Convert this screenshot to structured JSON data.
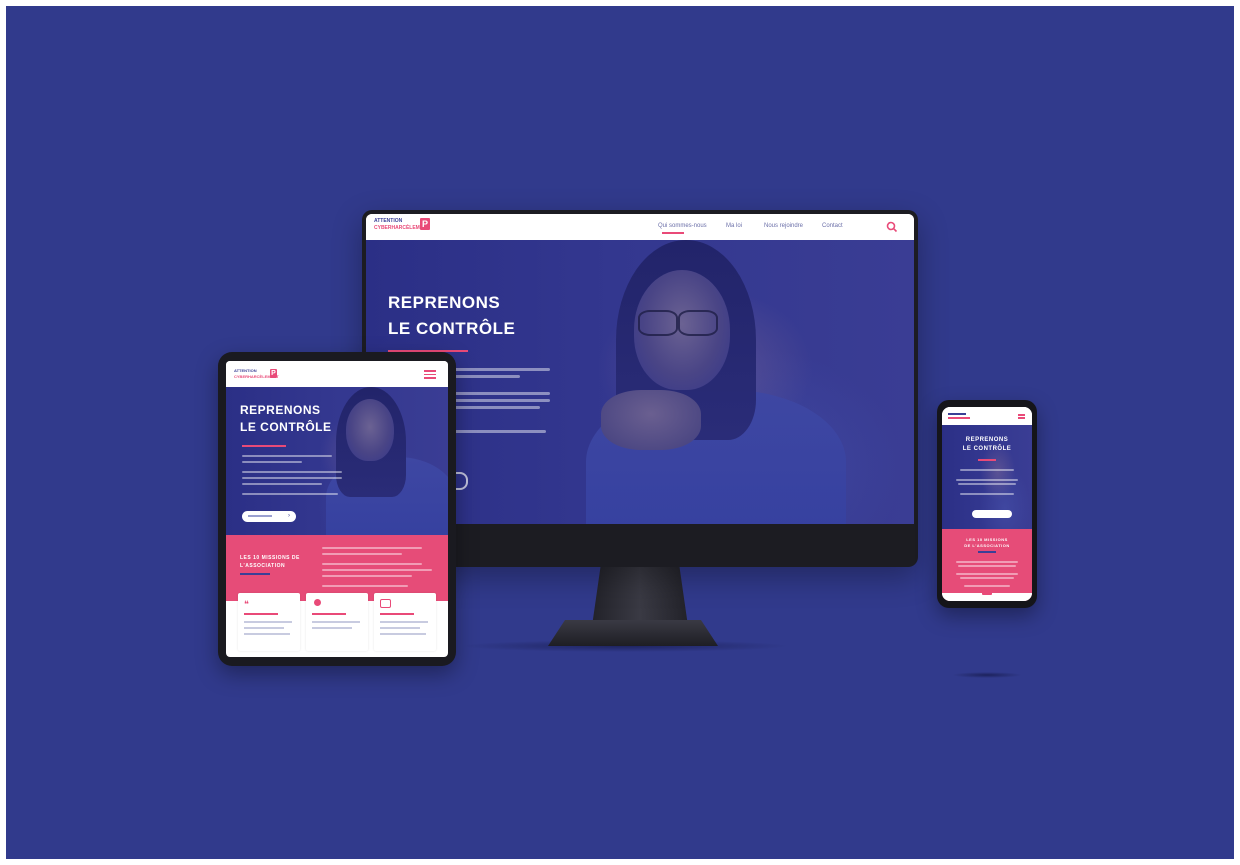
{
  "colors": {
    "background": "#313a8c",
    "accent": "#e94a78",
    "brand_blue": "#3a3f96"
  },
  "desktop": {
    "logo": {
      "line1": "ATTENTION",
      "line2": "CYBERHARCÈLEMENT",
      "mark": "P"
    },
    "nav": [
      "Qui sommes-nous",
      "Ma loi",
      "Nous rejoindre",
      "Contact"
    ],
    "search_icon": "search-icon",
    "hero_title_line1": "REPRENONS",
    "hero_title_line2": "LE CONTRÔLE"
  },
  "tablet": {
    "menu_icon": "hamburger-icon",
    "hero_title_line1": "REPRENONS",
    "hero_title_line2": "LE CONTRÔLE",
    "cta_icon": "arrow-right-icon",
    "panel_title_line1": "LES 10 MISSIONS DE",
    "panel_title_line2": "L'ASSOCIATION",
    "card_icons": [
      "megaphone-icon",
      "person-icon",
      "chat-icon"
    ]
  },
  "mobile": {
    "hero_title_line1": "REPRENONS",
    "hero_title_line2": "LE CONTRÔLE",
    "panel_title_line1": "LES 10 MISSIONS",
    "panel_title_line2": "DE L'ASSOCIATION"
  }
}
